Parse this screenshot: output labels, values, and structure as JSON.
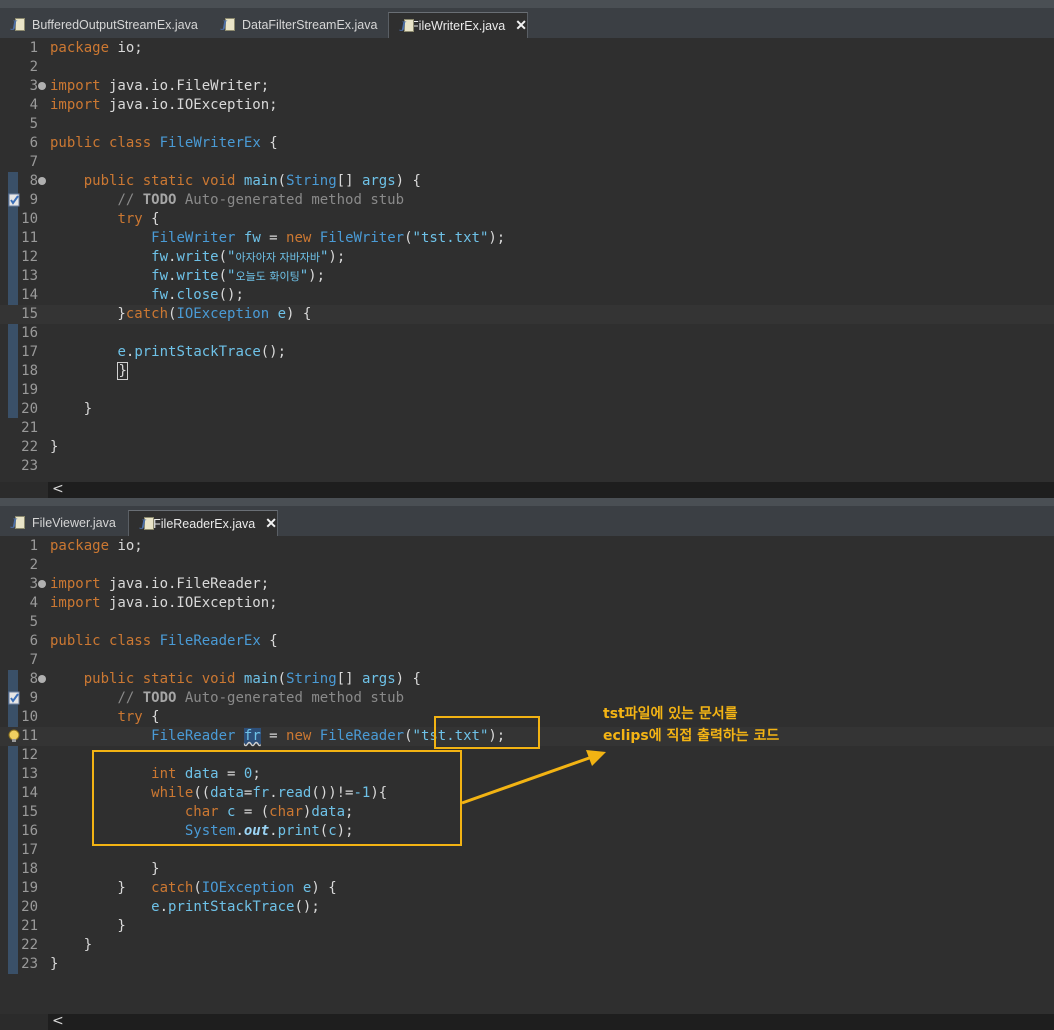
{
  "top_editor": {
    "tabs": [
      {
        "label": "BufferedOutputStreamEx.java",
        "active": false
      },
      {
        "label": "DataFilterStreamEx.java",
        "active": false
      },
      {
        "label": "FileWriterEx.java",
        "active": true
      }
    ],
    "close_glyph": "✕",
    "line_numbers": [
      "1",
      "2",
      "3",
      "4",
      "5",
      "6",
      "7",
      "8",
      "9",
      "10",
      "11",
      "12",
      "13",
      "14",
      "15",
      "16",
      "17",
      "18",
      "19",
      "20",
      "21",
      "22",
      "23"
    ],
    "code": {
      "package_kw": "package",
      "package_name": " io;",
      "import_kw": "import",
      "import1": " java.io.FileWriter;",
      "import2": " java.io.IOException;",
      "public_kw": "public",
      "class_kw": "class",
      "class_name": "FileWriterEx",
      "static_kw": "static",
      "void_kw": "void",
      "main_name": "main",
      "string_type": "String",
      "args": "args",
      "todo_prefix": "// ",
      "todo_word": "TODO",
      "todo_rest": " Auto-generated method stub",
      "try_kw": "try",
      "filewriter_type": "FileWriter",
      "fw_var": "fw",
      "new_kw": "new",
      "file_literal": "\"tst.txt\"",
      "write_method": "write",
      "write1_text": "아자아자 자바자바",
      "write2_text": "오늘도 화이팅",
      "close_method": "close",
      "catch_kw": "catch",
      "ioexception_type": "IOException",
      "e_var": "e",
      "printstacktrace": "printStackTrace"
    },
    "scroll_arrow": "<"
  },
  "bottom_editor": {
    "tabs": [
      {
        "label": "FileViewer.java",
        "active": false
      },
      {
        "label": "FileReaderEx.java",
        "active": true
      }
    ],
    "close_glyph": "✕",
    "line_numbers": [
      "1",
      "2",
      "3",
      "4",
      "5",
      "6",
      "7",
      "8",
      "9",
      "10",
      "11",
      "12",
      "13",
      "14",
      "15",
      "16",
      "17",
      "18",
      "19",
      "20",
      "21",
      "22",
      "23"
    ],
    "code": {
      "import1": " java.io.FileReader;",
      "import2": " java.io.IOException;",
      "class_name": "FileReaderEx",
      "filereader_type": "FileReader",
      "fr_var": "fr",
      "int_kw": "int",
      "data_var": "data",
      "zero": "0",
      "while_kw": "while",
      "read_method": "read",
      "minus_one": "-1",
      "char_kw": "char",
      "c_var": "c",
      "system": "System",
      "out_field": "out",
      "print_method": "print"
    },
    "scroll_arrow": "<"
  },
  "annotation": {
    "line1": "tst파일에 있는 문서를",
    "line2": "eclips에 직접 출력하는 코드",
    "color": "#f4b414"
  }
}
